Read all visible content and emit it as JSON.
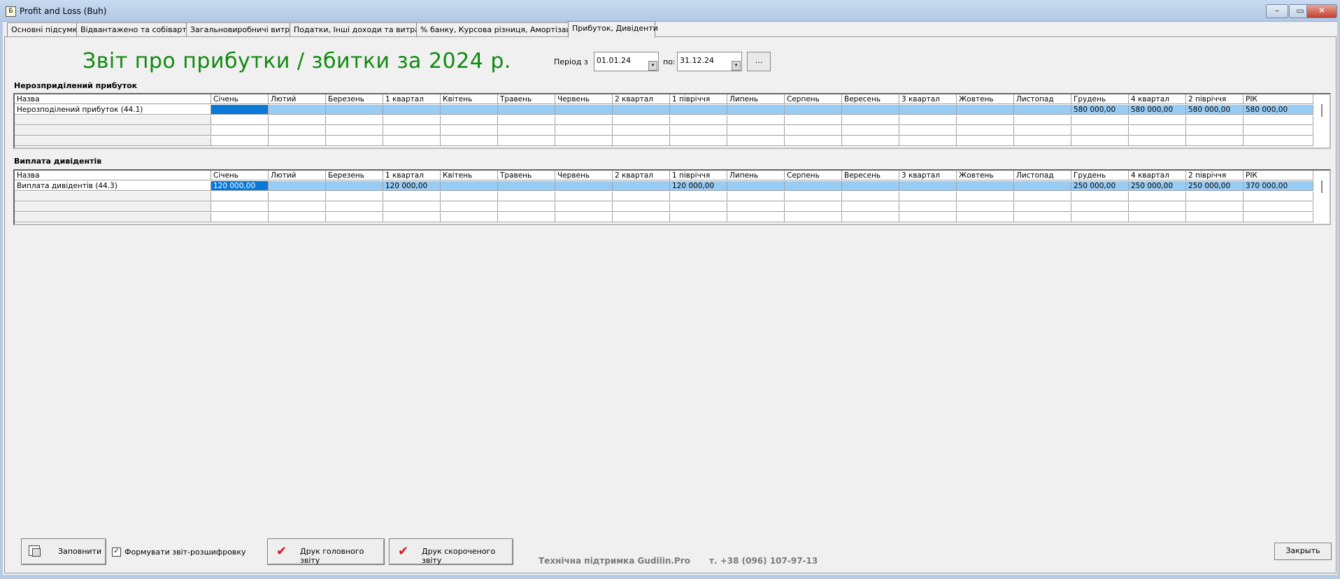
{
  "window": {
    "title": "Profit and Loss (Buh)",
    "min_icon": "minimize-icon",
    "max_icon": "maximize-icon",
    "close_icon": "close-icon"
  },
  "tabs": [
    {
      "label": "Основні підсумки"
    },
    {
      "label": "Відвантажено та собівартість"
    },
    {
      "label": "Загальновиробничі витрати"
    },
    {
      "label": "Податки, Інші доходи та витрати"
    },
    {
      "label": "% банку, Курсова різниця, Амортізація"
    },
    {
      "label": "Прибуток, Дивіденти",
      "active": true
    }
  ],
  "report": {
    "title": "Звіт про прибутки / збитки за 2024 р.",
    "period_from_label": "Період з",
    "period_from": "01.01.24",
    "period_to_label": "по:",
    "period_to": "31.12.24",
    "dots_label": "..."
  },
  "columns": [
    "Назва",
    "Січень",
    "Лютий",
    "Березень",
    "1 квартал",
    "Квітень",
    "Травень",
    "Червень",
    "2 квартал",
    "1 півріччя",
    "Липень",
    "Серпень",
    "Вересень",
    "3 квартал",
    "Жовтень",
    "Листопад",
    "Грудень",
    "4 квартал",
    "2 півріччя",
    "РІК"
  ],
  "retained": {
    "title": "Нерозприділений прибуток",
    "rows": [
      [
        "Нерозподілений прибуток (44.1)",
        "",
        "",
        "",
        "",
        "",
        "",
        "",
        "",
        "",
        "",
        "",
        "",
        "",
        "",
        "",
        "580 000,00",
        "580 000,00",
        "580 000,00",
        "580 000,00"
      ]
    ]
  },
  "dividends": {
    "title": "Виплата дивідентів",
    "rows": [
      [
        "Виплата дивідентів (44.3)",
        "120 000,00",
        "",
        "",
        "120 000,00",
        "",
        "",
        "",
        "",
        "120 000,00",
        "",
        "",
        "",
        "",
        "",
        "",
        "250 000,00",
        "250 000,00",
        "250 000,00",
        "370 000,00"
      ]
    ]
  },
  "bottom": {
    "fill_label": "Заповнити",
    "checkbox_label": "Формувати звіт-розшифровку",
    "checkbox_checked": "✓",
    "print_main_label": "Друк головного звіту",
    "print_short_label": "Друк скороченого звіту",
    "support_text": "Технічна підтримка Gudilin.Pro",
    "support_phone": "т. +38 (096) 107-97-13",
    "close_label": "Закрыть"
  }
}
